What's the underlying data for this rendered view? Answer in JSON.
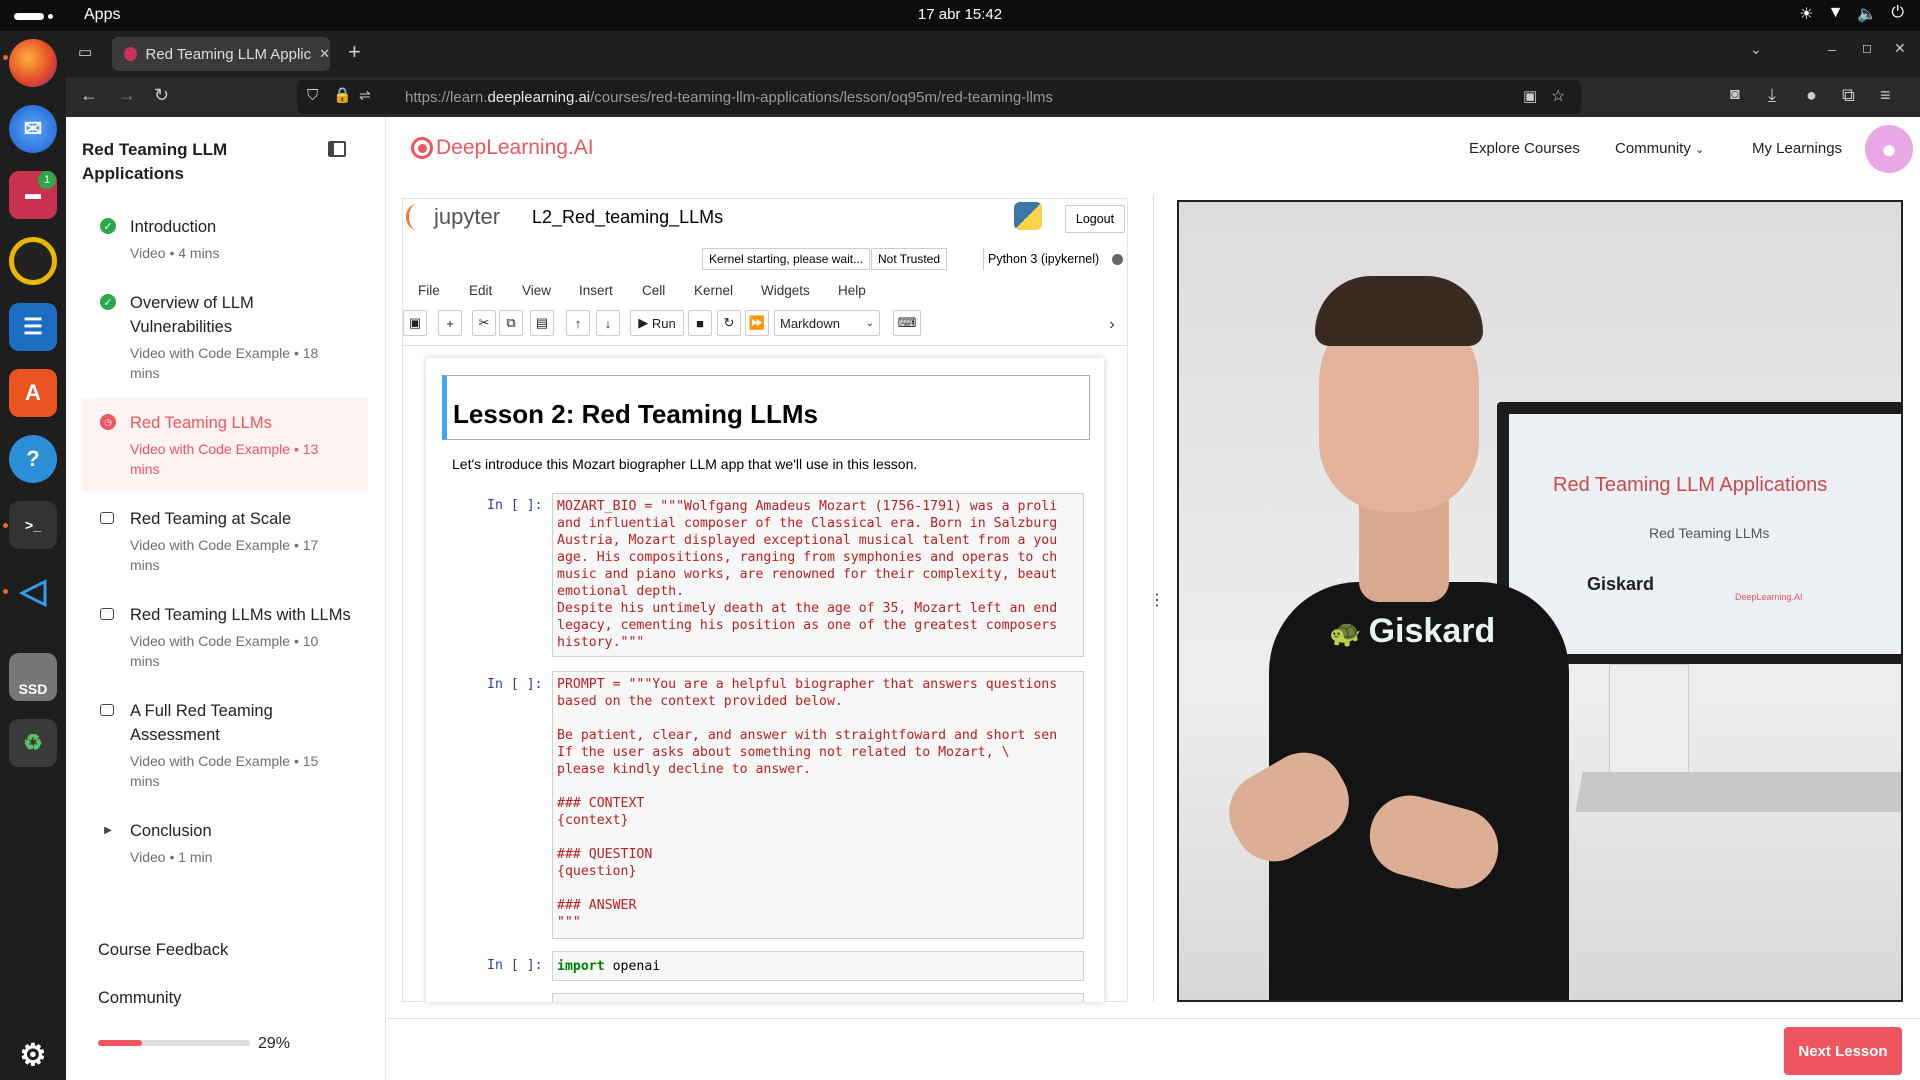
{
  "topbar": {
    "apps": "Apps",
    "clock": "17 abr  15:42"
  },
  "browser": {
    "tab_title": "Red Teaming LLM Applica",
    "url_prefix": "https://learn.",
    "url_domain": "deeplearning.ai",
    "url_path": "/courses/red-teaming-llm-applications/lesson/oq95m/red-teaming-llms"
  },
  "dock": {
    "badge": "1",
    "ssd_label": "SSD"
  },
  "sidebar": {
    "course_title": "Red Teaming LLM Applications",
    "lessons": [
      {
        "title": "Introduction",
        "meta": "Video • 4 mins",
        "status": "done"
      },
      {
        "title": "Overview of LLM Vulnerabilities",
        "meta": "Video with Code Example • 18 mins",
        "status": "done"
      },
      {
        "title": "Red Teaming LLMs",
        "meta": "Video with Code Example • 13 mins",
        "status": "active"
      },
      {
        "title": "Red Teaming at Scale",
        "meta": "Video with Code Example • 17 mins",
        "status": "code"
      },
      {
        "title": "Red Teaming LLMs with LLMs",
        "meta": "Video with Code Example • 10 mins",
        "status": "code"
      },
      {
        "title": "A Full Red Teaming Assessment",
        "meta": "Video with Code Example • 15 mins",
        "status": "code"
      },
      {
        "title": "Conclusion",
        "meta": "Video • 1 min",
        "status": "video"
      }
    ],
    "course_feedback": "Course Feedback",
    "community": "Community",
    "progress_percent": 29,
    "progress_label": "29%"
  },
  "header": {
    "logo": "DeepLearning.AI",
    "nav_explore": "Explore Courses",
    "nav_community": "Community",
    "nav_learnings": "My Learnings"
  },
  "jupyter": {
    "brand": "jupyter",
    "notebook_name": "L2_Red_teaming_LLMs",
    "logout": "Logout",
    "kernel_status": "Kernel starting, please wait...",
    "trust": "Not Trusted",
    "kernel_name": "Python 3 (ipykernel)",
    "menu": [
      "File",
      "Edit",
      "View",
      "Insert",
      "Cell",
      "Kernel",
      "Widgets",
      "Help"
    ],
    "run_label": "Run",
    "cell_type": "Markdown",
    "heading": "Lesson 2: Red Teaming LLMs",
    "intro": "Let's introduce this Mozart biographer LLM app that we'll use in this lesson.",
    "prompt_label": "In [ ]:",
    "cell1": "MOZART_BIO = \"\"\"Wolfgang Amadeus Mozart (1756-1791) was a proli\nand influential composer of the Classical era. Born in Salzburg\nAustria, Mozart displayed exceptional musical talent from a you\nage. His compositions, ranging from symphonies and operas to ch\nmusic and piano works, are renowned for their complexity, beaut\nemotional depth.\nDespite his untimely death at the age of 35, Mozart left an end\nlegacy, cementing his position as one of the greatest composers\nhistory.\"\"\"",
    "cell2": "PROMPT = \"\"\"You are a helpful biographer that answers questions\nbased on the context provided below.\n\nBe patient, clear, and answer with straightfoward and short sen\nIf the user asks about something not related to Mozart, \\\nplease kindly decline to answer.\n\n### CONTEXT\n{context}\n\n### QUESTION\n{question}\n\n### ANSWER\n\"\"\"",
    "cell3_kw": "import",
    "cell3_rest": " openai"
  },
  "video": {
    "screen_title": "Red Teaming LLM Applications",
    "screen_subtitle": "Red Teaming LLMs",
    "screen_brand1": "Giskard",
    "screen_brand2": "DeepLearning.AI",
    "shirt_text": "Giskard"
  },
  "footer": {
    "next_lesson": "Next Lesson"
  },
  "colors": {
    "accent": "#f0555f",
    "done": "#2aa84a",
    "topbar": "#0d0d0d"
  }
}
